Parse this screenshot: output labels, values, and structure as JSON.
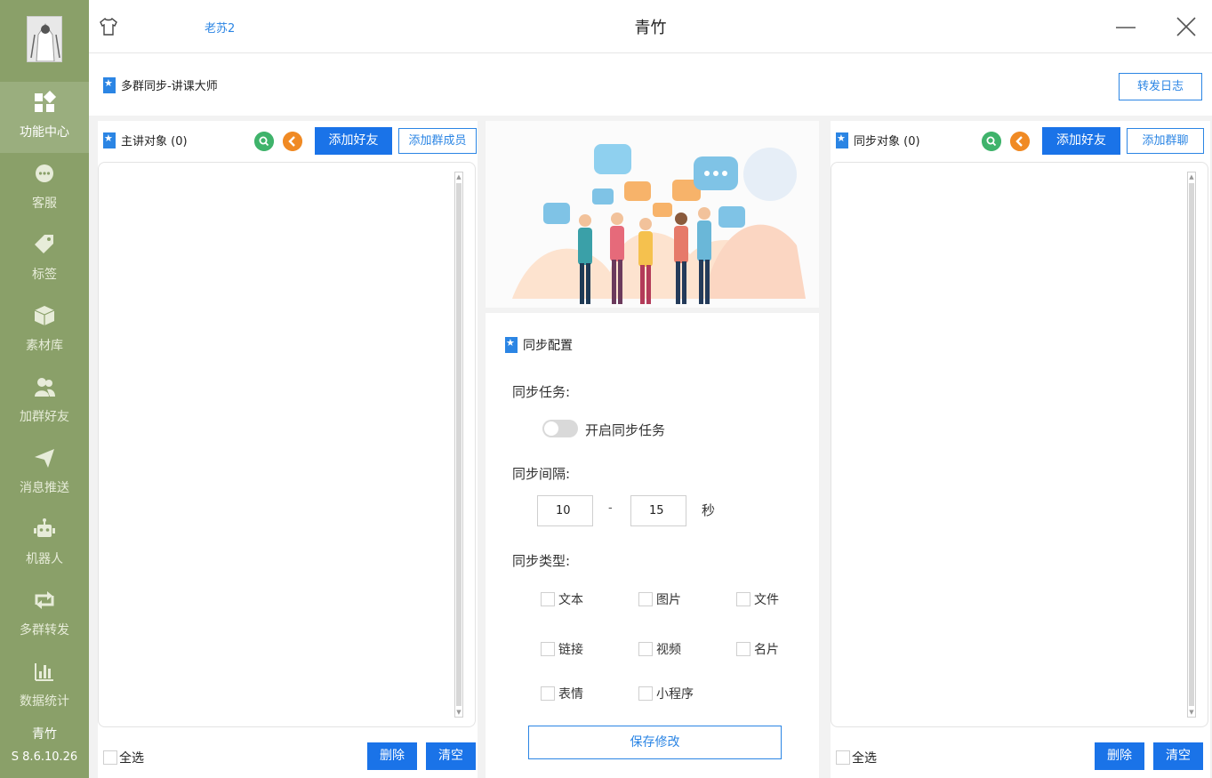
{
  "window": {
    "title": "青竹",
    "user": "老苏2"
  },
  "sidebar": {
    "items": [
      {
        "label": "功能中心",
        "icon": "grid-icon",
        "active": true
      },
      {
        "label": "客服",
        "icon": "chat-icon"
      },
      {
        "label": "标签",
        "icon": "tag-icon"
      },
      {
        "label": "素材库",
        "icon": "box-icon"
      },
      {
        "label": "加群好友",
        "icon": "users-icon"
      },
      {
        "label": "消息推送",
        "icon": "send-icon"
      },
      {
        "label": "机器人",
        "icon": "robot-icon"
      },
      {
        "label": "多群转发",
        "icon": "repeat-icon"
      },
      {
        "label": "数据统计",
        "icon": "chart-icon"
      }
    ],
    "app_name": "青竹",
    "version": "S 8.6.10.26"
  },
  "page": {
    "title": "多群同步-讲课大师",
    "log_button": "转发日志"
  },
  "left_panel": {
    "title": "主讲对象 (0)",
    "add_friend": "添加好友",
    "add_member": "添加群成员",
    "select_all": "全选",
    "delete": "删除",
    "clear": "清空"
  },
  "right_panel": {
    "title": "同步对象 (0)",
    "add_friend": "添加好友",
    "add_group": "添加群聊",
    "select_all": "全选",
    "delete": "删除",
    "clear": "清空"
  },
  "config": {
    "title": "同步配置",
    "task_label": "同步任务:",
    "toggle_label": "开启同步任务",
    "toggle_on": false,
    "interval_label": "同步间隔:",
    "interval_min": "10",
    "interval_sep": "-",
    "interval_max": "15",
    "interval_unit": "秒",
    "type_label": "同步类型:",
    "types": [
      "文本",
      "图片",
      "文件",
      "链接",
      "视频",
      "名片",
      "表情",
      "小程序"
    ],
    "save": "保存修改"
  },
  "colors": {
    "sidebar": "#8aa069",
    "accent": "#1a73e8",
    "link": "#2b85e4"
  }
}
